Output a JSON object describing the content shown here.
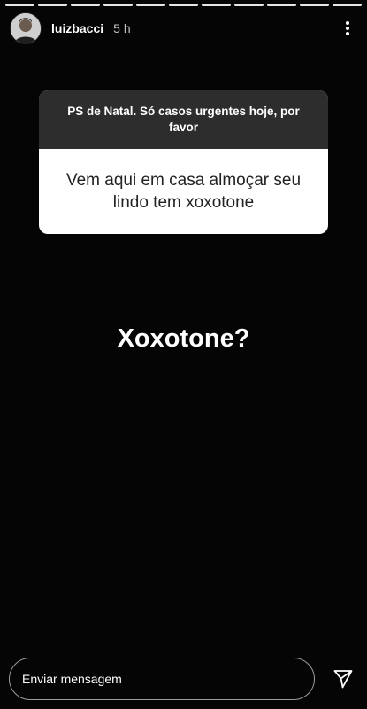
{
  "story": {
    "segments_total": 11,
    "user": {
      "username": "luizbacci",
      "time": "5 h",
      "avatar_icon": "avatar-photo"
    },
    "menu_icon": "more-vertical-icon"
  },
  "question_card": {
    "question": "PS de Natal. Só casos urgentes hoje, por favor",
    "answer": "Vem aqui em casa almoçar seu lindo tem xoxotone"
  },
  "caption": "Xoxotone?",
  "footer": {
    "message_placeholder": "Enviar mensagem",
    "send_icon": "send-icon"
  }
}
